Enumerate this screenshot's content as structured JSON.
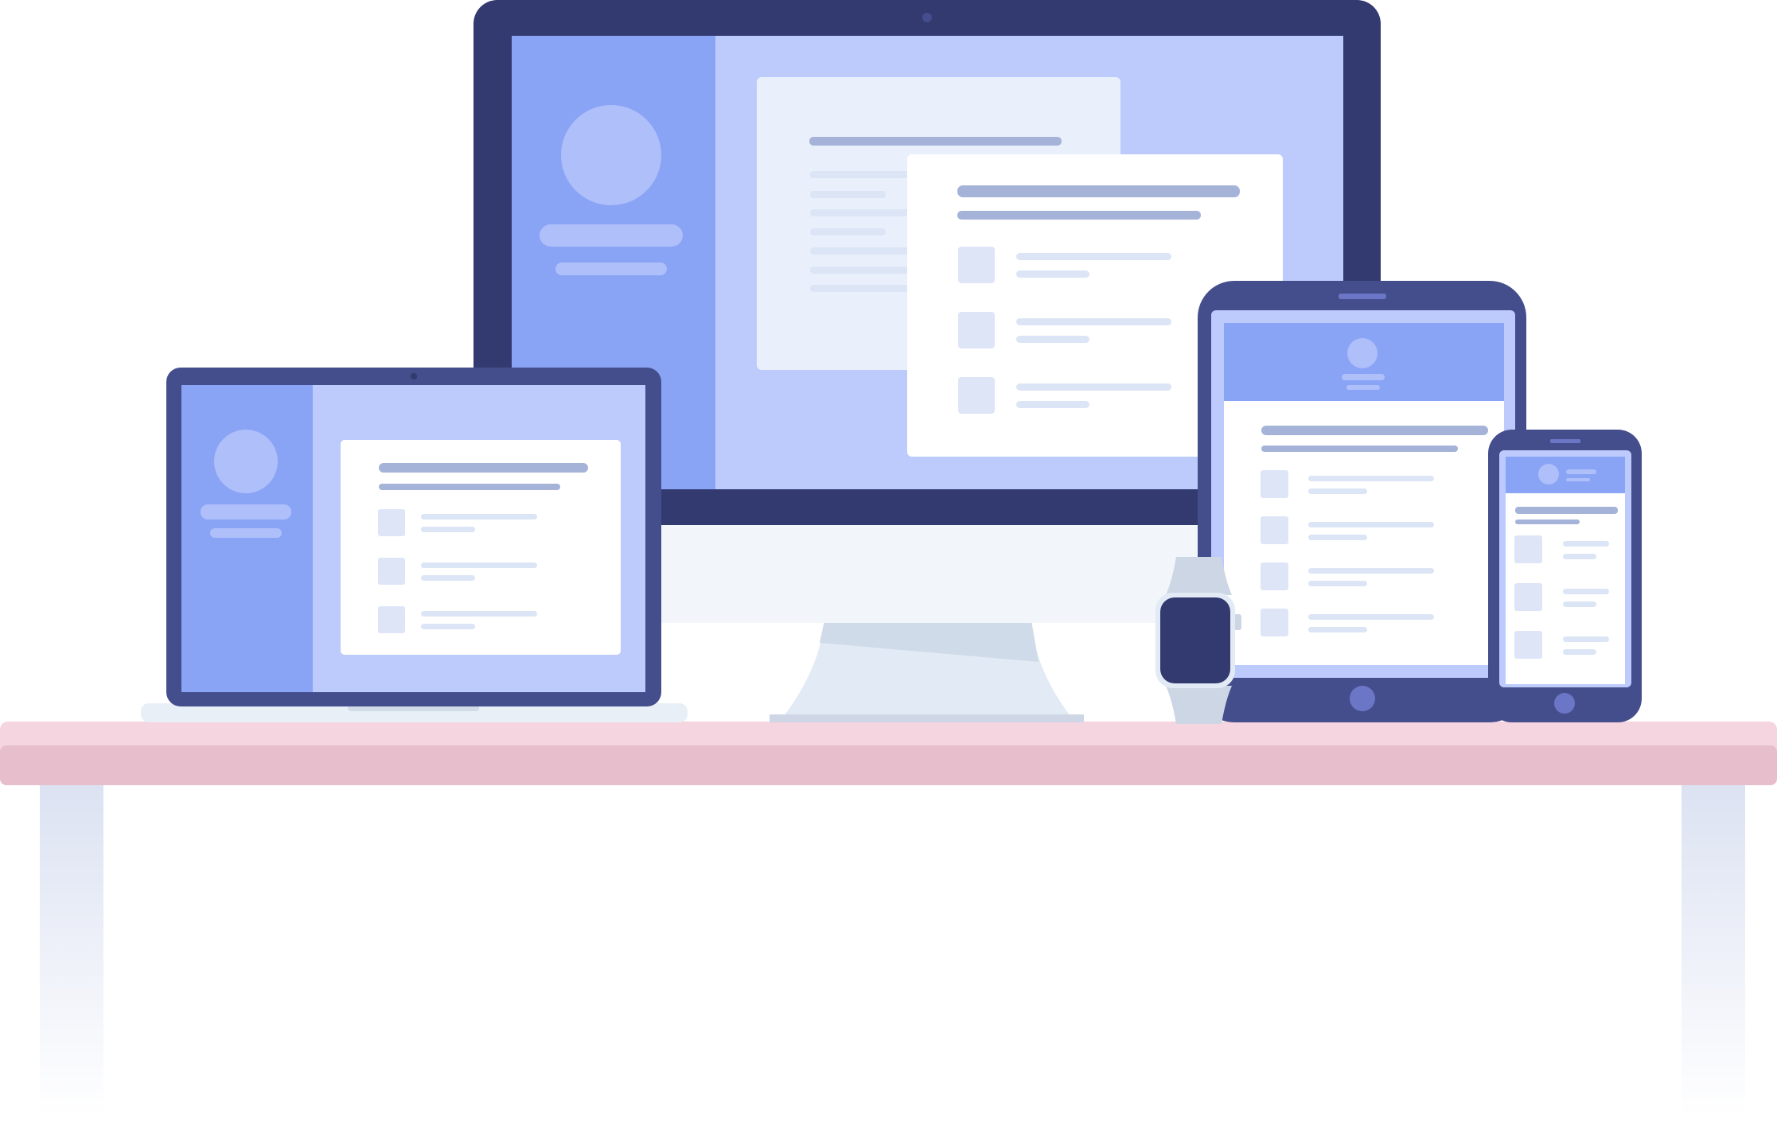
{
  "palette": {
    "frame_dark": "#323A70",
    "frame_mid": "#454E8C",
    "sidebar": "#8AA4F5",
    "screen_bg": "#BCCBFC",
    "panel_light": "#EAF0FB",
    "card": "#FFFFFF",
    "avatar": "#AEBFFA",
    "text_line_dark": "#A5B3D8",
    "text_line_light": "#DCE5F5",
    "thumb": "#DDE5F7",
    "stand": "#E2EBF5",
    "stand_shadow": "#CFDBE9",
    "watch_band": "#CDD6E4",
    "desk_top": "#F5D5DF",
    "desk_front": "#E7BECB",
    "desk_leg": "#E2E6F3",
    "home_button": "#6B77C6"
  },
  "devices": [
    "desktop-monitor",
    "laptop",
    "tablet",
    "smartphone",
    "smartwatch"
  ],
  "content": {
    "monitor_rows": 3,
    "laptop_rows": 3,
    "tablet_rows": 4,
    "phone_rows": 3
  }
}
